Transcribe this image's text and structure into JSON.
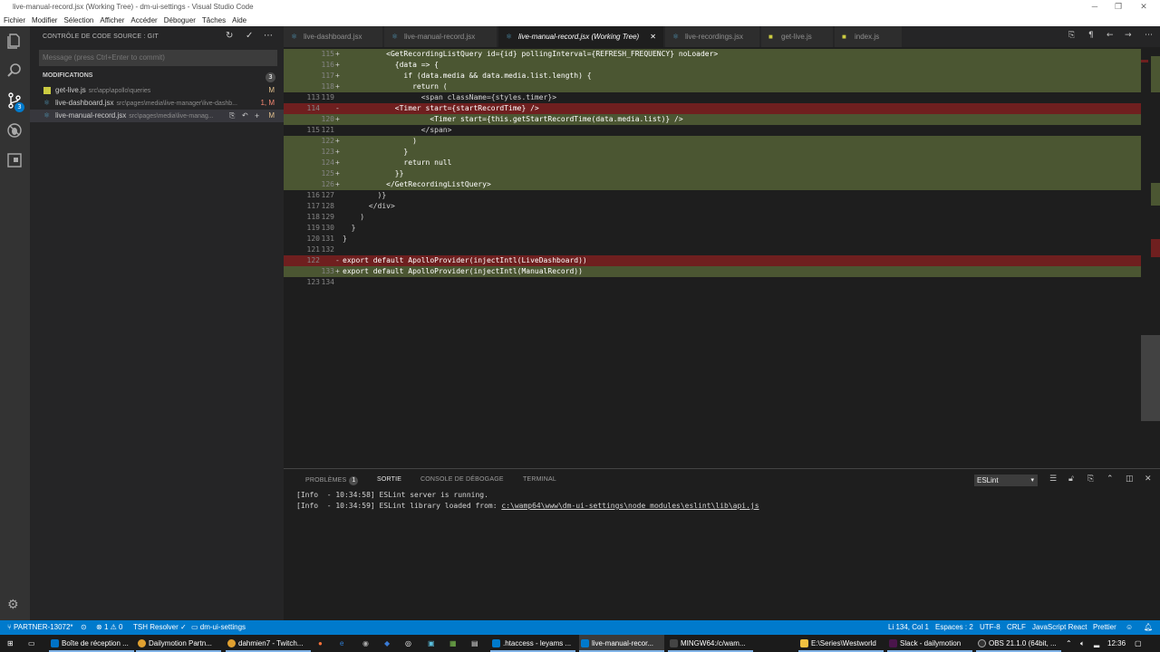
{
  "window": {
    "title": "live-manual-record.jsx (Working Tree) - dm-ui-settings - Visual Studio Code"
  },
  "menu": [
    "Fichier",
    "Modifier",
    "Sélection",
    "Afficher",
    "Accéder",
    "Déboguer",
    "Tâches",
    "Aide"
  ],
  "activity_bar": {
    "items": [
      "files-icon",
      "search-icon",
      "source-control-icon",
      "debug-icon",
      "extensions-icon"
    ],
    "scm_badge": "3"
  },
  "sidebar": {
    "header": "CONTRÔLE DE CODE SOURCE : GIT",
    "commit_placeholder": "Message (press Ctrl+Enter to commit)",
    "modifications_label": "MODIFICATIONS",
    "modifications_count": "3",
    "files": [
      {
        "name": "get-live.js",
        "path": "src\\app\\apollo\\queries",
        "status": "M",
        "icon_color": "#cbcb41"
      },
      {
        "name": "live-dashboard.jsx",
        "path": "src\\pages\\media\\live-manager\\live-dashb...",
        "status": "1, M",
        "icon_color": "#519aba"
      },
      {
        "name": "live-manual-record.jsx",
        "path": "src\\pages\\media\\live-manag...",
        "status": "M",
        "icon_color": "#519aba"
      }
    ]
  },
  "tabs": [
    {
      "label": "live-dashboard.jsx",
      "icon_color": "#519aba"
    },
    {
      "label": "live-manual-record.jsx",
      "icon_color": "#519aba"
    },
    {
      "label": "live-manual-record.jsx (Working Tree)",
      "icon_color": "#519aba",
      "close": "✕"
    },
    {
      "label": "live-recordings.jsx",
      "icon_color": "#519aba"
    },
    {
      "label": "get-live.js",
      "icon_color": "#cbcb41"
    },
    {
      "label": "index.js",
      "icon_color": "#cbcb41"
    }
  ],
  "editor": {
    "lines": [
      {
        "type": "add",
        "old": "",
        "new": "115",
        "mark": "+",
        "code": "          <GetRecordingListQuery id={id} pollingInterval={REFRESH_FREQUENCY} noLoader>"
      },
      {
        "type": "add",
        "old": "",
        "new": "116",
        "mark": "+",
        "code": "            {data => {"
      },
      {
        "type": "add",
        "old": "",
        "new": "117",
        "mark": "+",
        "code": "              if (data.media && data.media.list.length) {"
      },
      {
        "type": "add",
        "old": "",
        "new": "118",
        "mark": "+",
        "code": "                return ("
      },
      {
        "type": "ctx",
        "old": "113",
        "new": "119",
        "mark": "",
        "code": "                  <span className={styles.timer}>"
      },
      {
        "type": "del",
        "old": "114",
        "new": "",
        "mark": "-",
        "code": "            <Timer start={startRecordTime} />"
      },
      {
        "type": "add",
        "old": "",
        "new": "120",
        "mark": "+",
        "code": "                    <Timer start={this.getStartRecordTime(data.media.list)} />"
      },
      {
        "type": "ctx",
        "old": "115",
        "new": "121",
        "mark": "",
        "code": "                  </span>"
      },
      {
        "type": "add",
        "old": "",
        "new": "122",
        "mark": "+",
        "code": "                )"
      },
      {
        "type": "add",
        "old": "",
        "new": "123",
        "mark": "+",
        "code": "              }"
      },
      {
        "type": "add",
        "old": "",
        "new": "124",
        "mark": "+",
        "code": "              return null"
      },
      {
        "type": "add",
        "old": "",
        "new": "125",
        "mark": "+",
        "code": "            }}"
      },
      {
        "type": "add",
        "old": "",
        "new": "126",
        "mark": "+",
        "code": "          </GetRecordingListQuery>"
      },
      {
        "type": "ctx",
        "old": "116",
        "new": "127",
        "mark": "",
        "code": "        )}"
      },
      {
        "type": "ctx",
        "old": "117",
        "new": "128",
        "mark": "",
        "code": "      </div>"
      },
      {
        "type": "ctx",
        "old": "118",
        "new": "129",
        "mark": "",
        "code": "    )"
      },
      {
        "type": "ctx",
        "old": "119",
        "new": "130",
        "mark": "",
        "code": "  }"
      },
      {
        "type": "ctx",
        "old": "120",
        "new": "131",
        "mark": "",
        "code": "}"
      },
      {
        "type": "ctx",
        "old": "121",
        "new": "132",
        "mark": "",
        "code": ""
      },
      {
        "type": "del",
        "old": "122",
        "new": "",
        "mark": "-",
        "code": "export default ApolloProvider(injectIntl(LiveDashboard))"
      },
      {
        "type": "add",
        "old": "",
        "new": "133",
        "mark": "+",
        "code": "export default ApolloProvider(injectIntl(ManualRecord))"
      },
      {
        "type": "ctx",
        "old": "123",
        "new": "134",
        "mark": "",
        "code": ""
      }
    ]
  },
  "panel": {
    "tabs": [
      "PROBLÈMES",
      "SORTIE",
      "CONSOLE DE DÉBOGAGE",
      "TERMINAL"
    ],
    "problems_count": "1",
    "output_channel": "ESLint",
    "output_lines": [
      {
        "prefix": "[Info  - 10:34:58] ESLint server is running.",
        "link": ""
      },
      {
        "prefix": "[Info  - 10:34:59] ESLint library loaded from: ",
        "link": "c:\\wamp64\\www\\dm-ui-settings\\node_modules\\eslint\\lib\\api.js"
      }
    ]
  },
  "statusbar": {
    "branch": "PARTNER-13072*",
    "errors": "1",
    "warnings": "0",
    "tsh": "TSH Resolver",
    "folder": "dm-ui-settings",
    "position": "Li 134, Col 1",
    "spaces": "Espaces : 2",
    "encoding": "UTF-8",
    "eol": "CRLF",
    "language": "JavaScript React",
    "formatter": "Prettier"
  },
  "taskbar": {
    "items": [
      {
        "label": "Boîte de réception ...",
        "color": "#0072c6"
      },
      {
        "label": "Dailymotion Partn...",
        "color": "#e0a030"
      },
      {
        "label": "dahmien7 - Twitch...",
        "color": "#e0a030"
      },
      {
        "label": ".htaccess - leyams ...",
        "color": "#007acc"
      },
      {
        "label": "live-manual-recor...",
        "color": "#007acc"
      },
      {
        "label": "MINGW64:/c/wam...",
        "color": "#444444"
      },
      {
        "label": "E:\\Series\\Westworld",
        "color": "#f0c040"
      },
      {
        "label": "Slack - dailymotion",
        "color": "#4a154b"
      },
      {
        "label": "OBS 21.1.0 (64bit, ...",
        "color": "#333333"
      }
    ],
    "clock": "12:36"
  }
}
